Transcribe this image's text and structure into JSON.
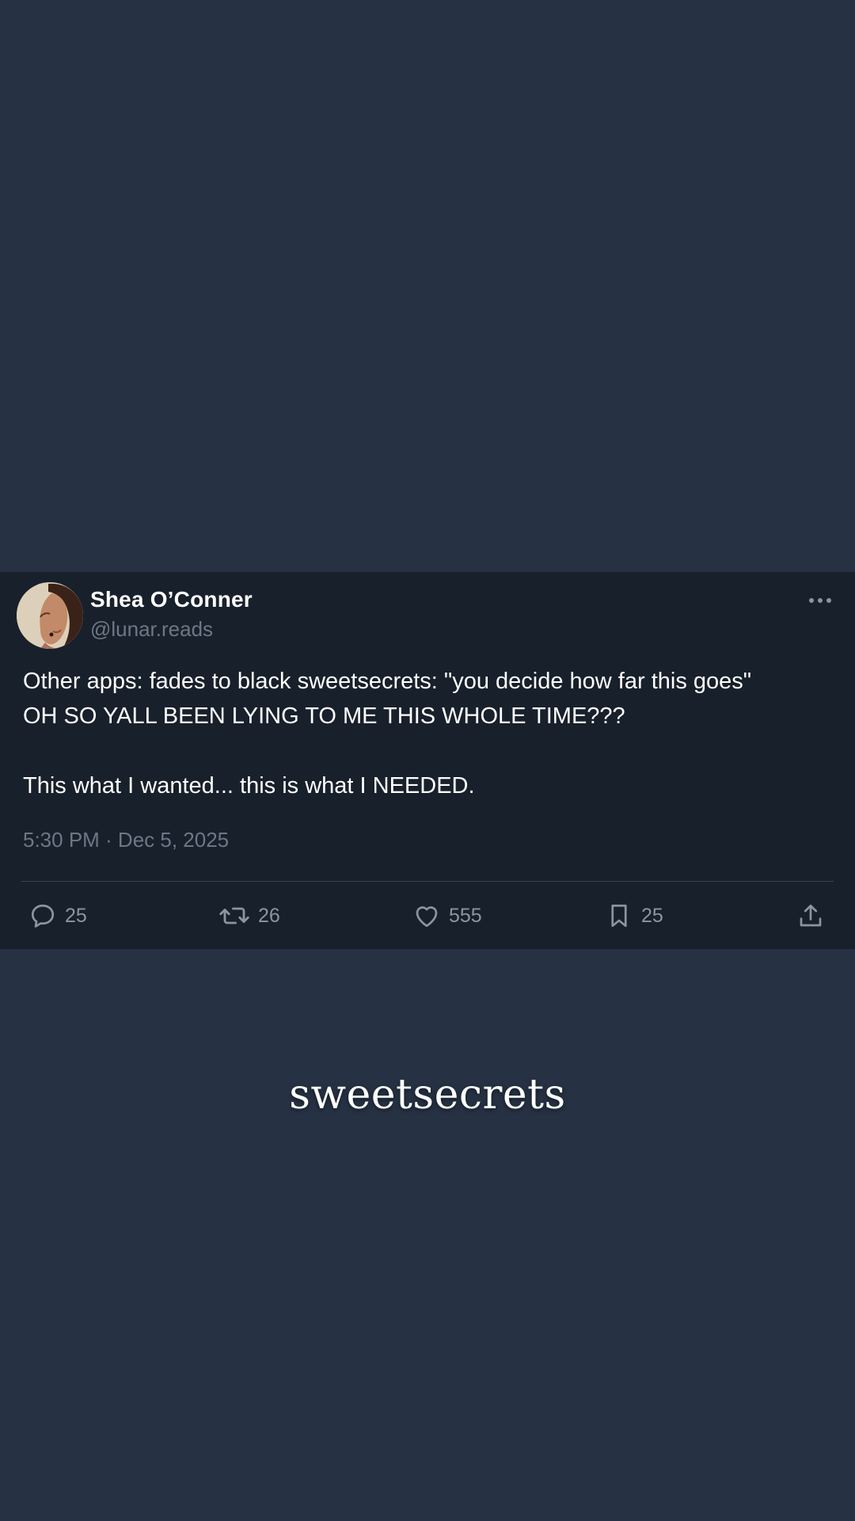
{
  "colors": {
    "page_background": "#263244",
    "card_background": "#18202b",
    "primary_text": "#ffffff",
    "secondary_text": "#6d7785",
    "icon_color": "#8b95a2"
  },
  "post": {
    "author": {
      "display_name": "Shea O’Conner",
      "handle": "@lunar.reads",
      "avatar_icon": "profile-photo"
    },
    "text_lines": [
      "Other apps: fades to black sweetsecrets: \"you decide how far this goes\"",
      "OH SO YALL BEEN LYING TO ME THIS WHOLE TIME???",
      "",
      "This what I wanted... this is what I NEEDED."
    ],
    "timestamp": "5:30 PM · Dec 5, 2025",
    "more_icon": "more-horizontal-icon",
    "actions": {
      "replies": {
        "icon": "comment-icon",
        "count": "25"
      },
      "reposts": {
        "icon": "repost-icon",
        "count": "26"
      },
      "likes": {
        "icon": "heart-icon",
        "count": "555"
      },
      "bookmarks": {
        "icon": "bookmark-icon",
        "count": "25"
      },
      "share": {
        "icon": "share-icon"
      }
    }
  },
  "brand": {
    "wordmark": "sweetsecrets"
  }
}
